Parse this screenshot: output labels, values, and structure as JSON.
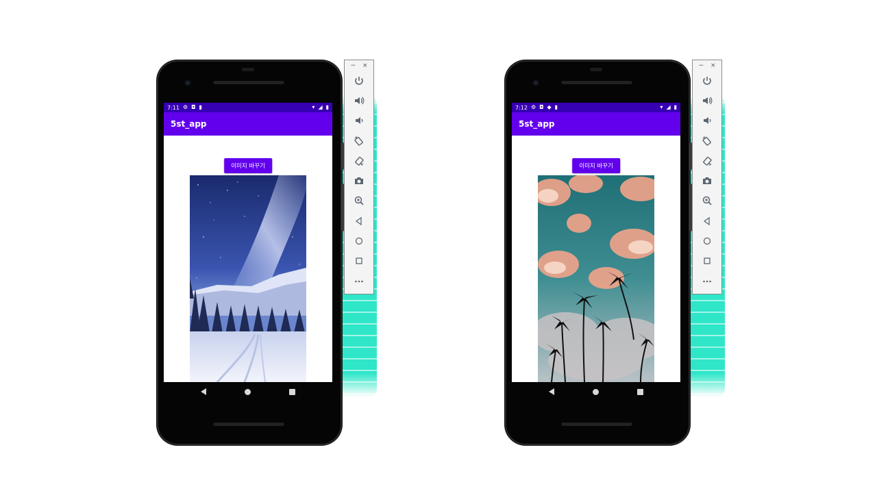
{
  "emulators": [
    {
      "status_time": "7:11",
      "app_title": "5st_app",
      "button_label": "이미지 바꾸기",
      "image_subject": "milky-way-snowy-mountains"
    },
    {
      "status_time": "7:12",
      "app_title": "5st_app",
      "button_label": "이미지 바꾸기",
      "image_subject": "palm-trees-pink-clouds"
    }
  ],
  "toolbar": {
    "minimize": "−",
    "close": "×",
    "items": [
      "power-icon",
      "volume-up-icon",
      "volume-down-icon",
      "rotate-left-icon",
      "rotate-right-icon",
      "camera-icon",
      "zoom-icon",
      "back-icon",
      "home-icon",
      "overview-icon",
      "more-icon"
    ]
  },
  "colors": {
    "statusbar": "#3700b3",
    "appbar": "#6200ee",
    "accent_brush": "#2fe6c8"
  }
}
